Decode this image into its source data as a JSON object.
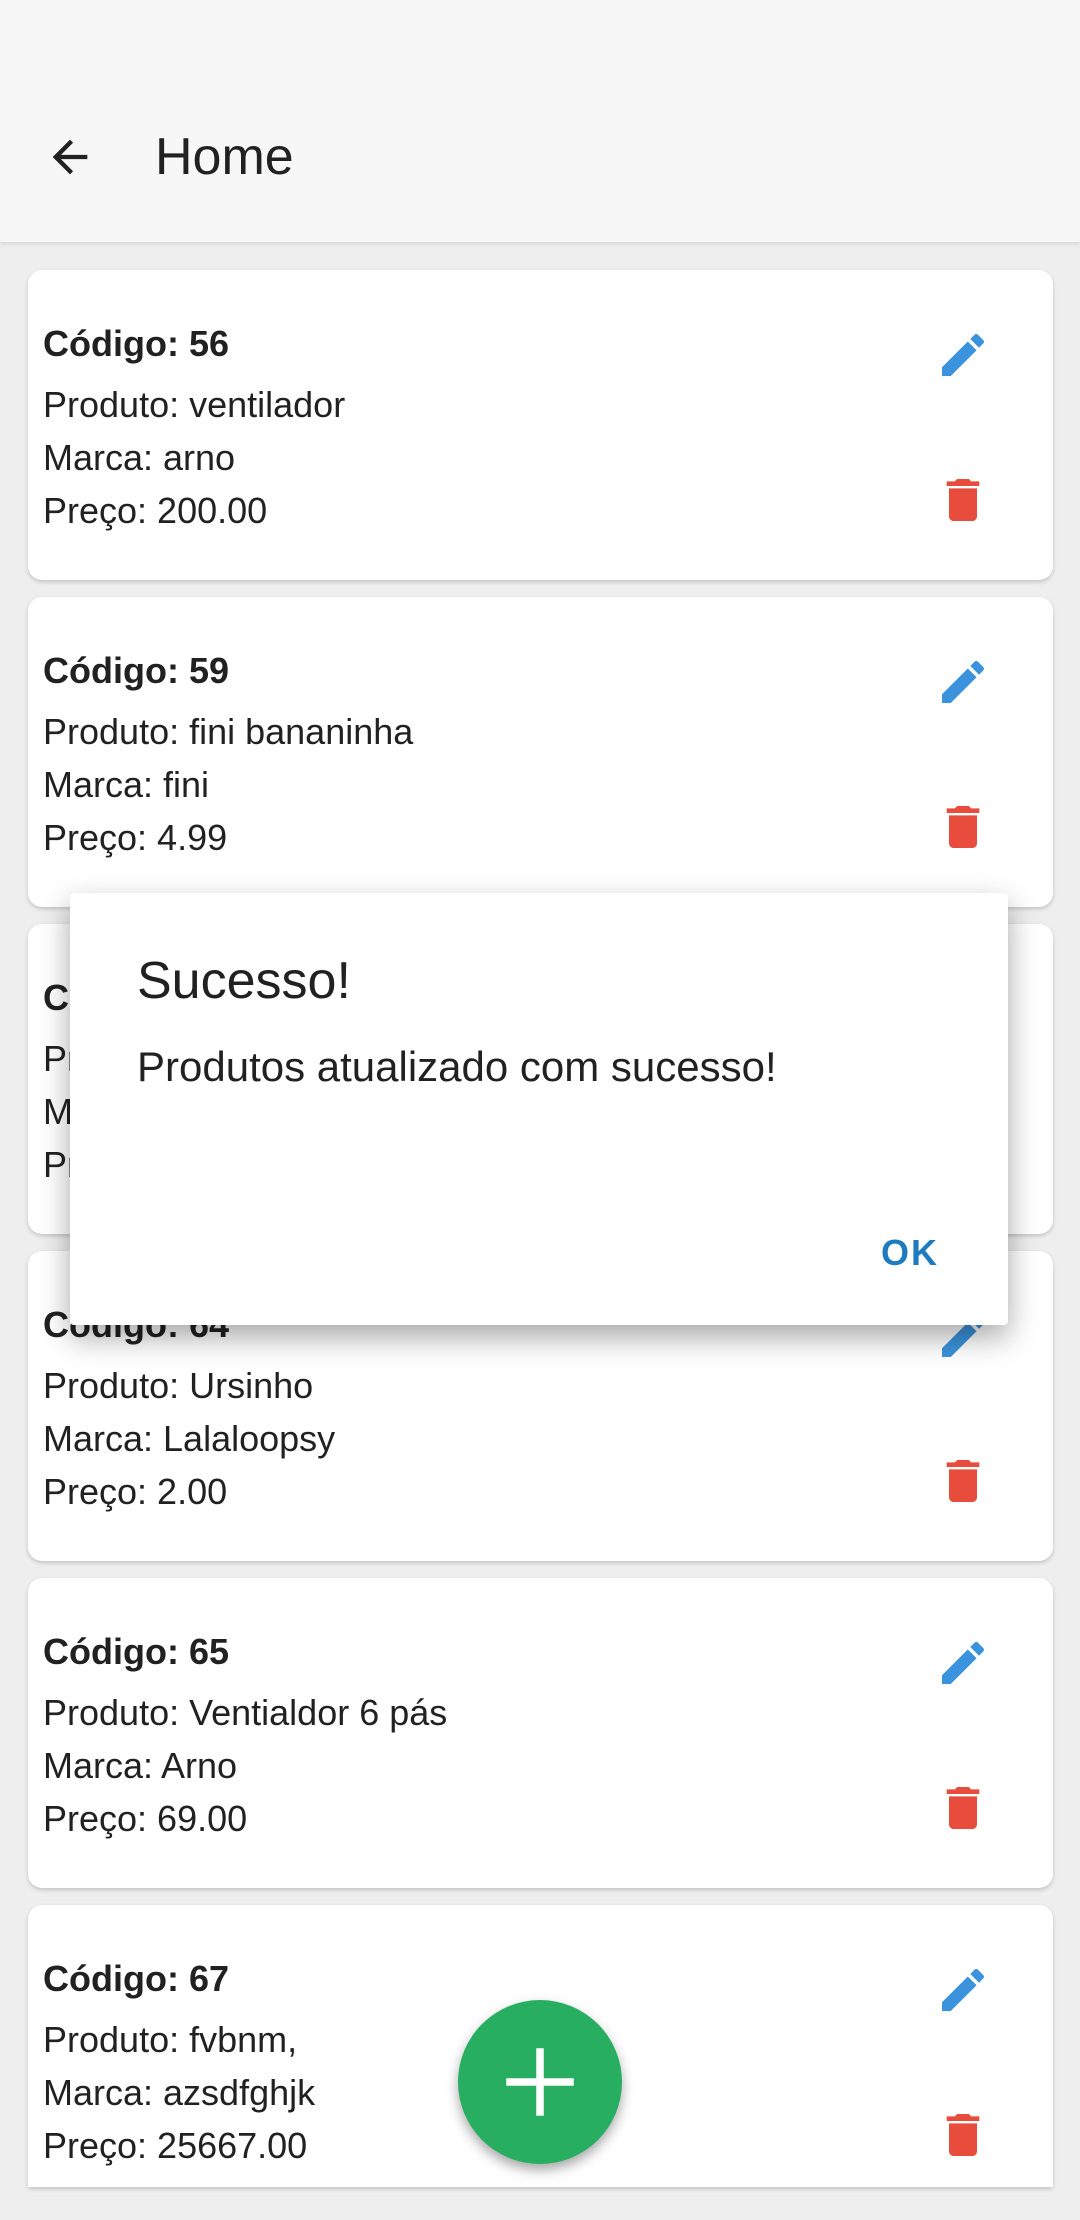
{
  "app_bar": {
    "title": "Home"
  },
  "products": [
    {
      "codigo": "Código: 56",
      "produto": "Produto: ventilador",
      "marca": "Marca: arno",
      "preco": "Preço: 200.00"
    },
    {
      "codigo": "Código: 59",
      "produto": "Produto: fini bananinha",
      "marca": "Marca: fini",
      "preco": "Preço: 4.99"
    },
    {
      "codigo": "Código",
      "produto": "Produto",
      "marca": "Marca",
      "preco": "Preço"
    },
    {
      "codigo": "Código: 64",
      "produto": "Produto: Ursinho",
      "marca": "Marca: Lalaloopsy",
      "preco": "Preço: 2.00"
    },
    {
      "codigo": "Código: 65",
      "produto": "Produto: Ventialdor 6 pás",
      "marca": "Marca: Arno",
      "preco": "Preço: 69.00"
    },
    {
      "codigo": "Código: 67",
      "produto": "Produto: fvbnm,",
      "marca": "Marca: azsdfghjk",
      "preco": "Preço: 25667.00"
    }
  ],
  "dialog": {
    "title": "Sucesso!",
    "message": "Produtos atualizado com sucesso!",
    "ok_label": "OK"
  },
  "colors": {
    "edit_icon": "#3a93dc",
    "delete_icon": "#e84c3d",
    "fab": "#27ae60",
    "dialog_button": "#1e7bbf"
  },
  "icons": {
    "back": "arrow-left-icon",
    "edit": "pencil-icon",
    "delete": "trash-icon",
    "fab": "plus-icon"
  }
}
